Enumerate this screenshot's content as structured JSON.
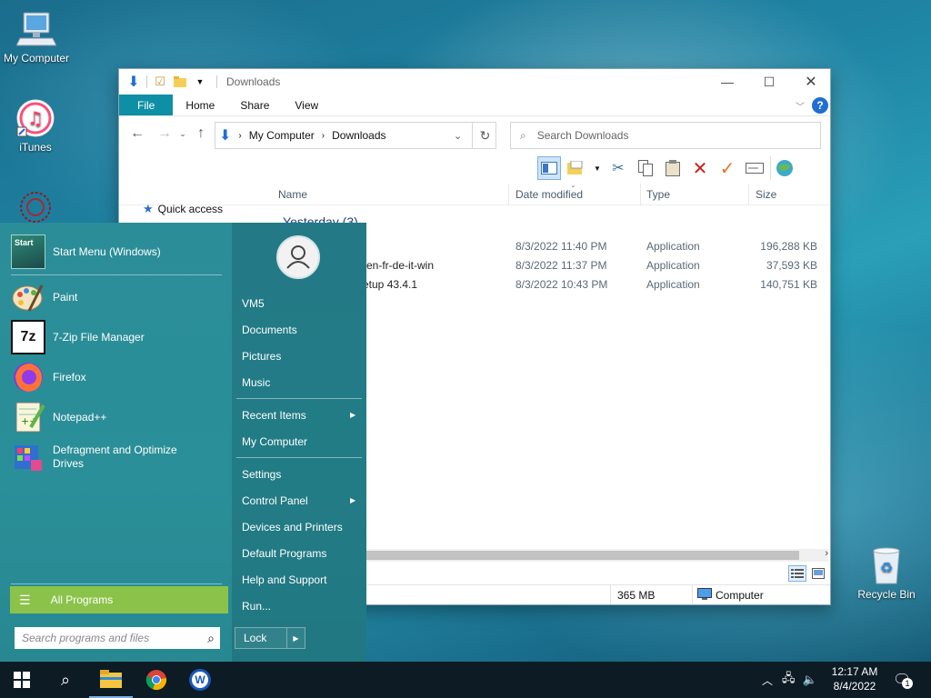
{
  "desktop": {
    "icons": [
      {
        "label": "My Computer",
        "icon": "computer-icon"
      },
      {
        "label": "iTunes",
        "icon": "itunes-icon"
      },
      {
        "label": "Recycle Bin",
        "icon": "recycle-bin-icon"
      }
    ]
  },
  "explorer": {
    "title": "Downloads",
    "tabs": [
      "File",
      "Home",
      "Share",
      "View"
    ],
    "address": {
      "root": "My Computer",
      "current": "Downloads"
    },
    "search_placeholder": "Search Downloads",
    "nav_pane": {
      "quick_access": "Quick access"
    },
    "columns": {
      "name": "Name",
      "date": "Date modified",
      "type": "Type",
      "size": "Size"
    },
    "group": "Yesterday (3)",
    "files": [
      {
        "name": "",
        "date": "8/3/2022 11:40 PM",
        "type": "Application",
        "size": "196,288 KB"
      },
      {
        "name": "-en-fr-de-it-win",
        "date": "8/3/2022 11:37 PM",
        "type": "Application",
        "size": "37,593 KB"
      },
      {
        "name": "etup 43.4.1",
        "date": "8/3/2022 10:43 PM",
        "type": "Application",
        "size": "140,751 KB"
      }
    ],
    "status": {
      "size": "365 MB",
      "location": "Computer"
    }
  },
  "start_menu": {
    "programs": [
      {
        "label": "Start Menu (Windows)",
        "icon": "start-menu-icon"
      },
      {
        "label": "Paint",
        "icon": "paint-icon"
      },
      {
        "label": "7-Zip File Manager",
        "icon": "7zip-icon",
        "icon_text": "7z"
      },
      {
        "label": "Firefox",
        "icon": "firefox-icon"
      },
      {
        "label": "Notepad++",
        "icon": "notepad-plus-plus-icon"
      },
      {
        "label": "Defragment and Optimize Drives",
        "icon": "defrag-icon"
      }
    ],
    "start_icon_text": "Start",
    "all_programs": "All Programs",
    "search_placeholder": "Search programs and files",
    "user": "VM5",
    "right_links": [
      {
        "label": "Documents"
      },
      {
        "label": "Pictures"
      },
      {
        "label": "Music"
      },
      {
        "label": "Recent Items",
        "arrow": true
      },
      {
        "label": "My Computer"
      },
      {
        "label": "Settings"
      },
      {
        "label": "Control Panel",
        "arrow": true
      },
      {
        "label": "Devices and Printers"
      },
      {
        "label": "Default Programs"
      },
      {
        "label": "Help and Support"
      },
      {
        "label": "Run..."
      }
    ],
    "lock": "Lock"
  },
  "taskbar": {
    "time": "12:17 AM",
    "date": "8/4/2022",
    "notification_count": "1"
  }
}
